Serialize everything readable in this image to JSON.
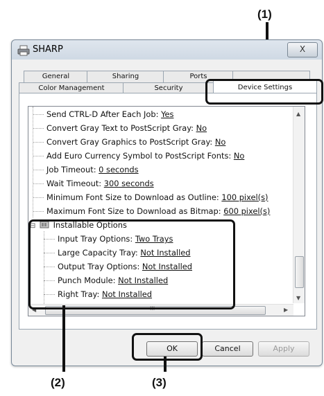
{
  "callouts": {
    "c1": "(1)",
    "c2": "(2)",
    "c3": "(3)"
  },
  "window": {
    "title": "SHARP",
    "close": "X"
  },
  "tabs": {
    "row1": [
      "General",
      "Sharing",
      "Ports",
      ""
    ],
    "row2": [
      "Color Management",
      "Security",
      "Device Settings"
    ]
  },
  "tree": {
    "items": [
      {
        "label": "Send CTRL-D After Each Job: ",
        "value": "Yes"
      },
      {
        "label": "Convert Gray Text to PostScript Gray: ",
        "value": "No"
      },
      {
        "label": "Convert Gray Graphics to PostScript Gray: ",
        "value": "No"
      },
      {
        "label": "Add Euro Currency Symbol to PostScript Fonts: ",
        "value": "No"
      },
      {
        "label": "Job Timeout: ",
        "value": "0 seconds"
      },
      {
        "label": "Wait Timeout: ",
        "value": "300 seconds"
      },
      {
        "label": "Minimum Font Size to Download as Outline: ",
        "value": "100 pixel(s)"
      },
      {
        "label": "Maximum Font Size to Download as Bitmap: ",
        "value": "600 pixel(s)"
      }
    ],
    "group_label": "Installable Options",
    "expander": "⊟",
    "options": [
      {
        "label": "Input Tray Options: ",
        "value": "Two Trays"
      },
      {
        "label": "Large Capacity Tray: ",
        "value": "Not Installed"
      },
      {
        "label": "Output Tray Options: ",
        "value": "Not Installed"
      },
      {
        "label": "Punch Module: ",
        "value": "Not Installed"
      },
      {
        "label": "Right Tray: ",
        "value": "Not Installed"
      }
    ],
    "hscroll_grip": "III"
  },
  "buttons": {
    "ok": "OK",
    "cancel": "Cancel",
    "apply": "Apply"
  },
  "colors": {
    "callout": "#111111",
    "window_border": "#7a8a99",
    "panel_bg": "#ffffff"
  }
}
